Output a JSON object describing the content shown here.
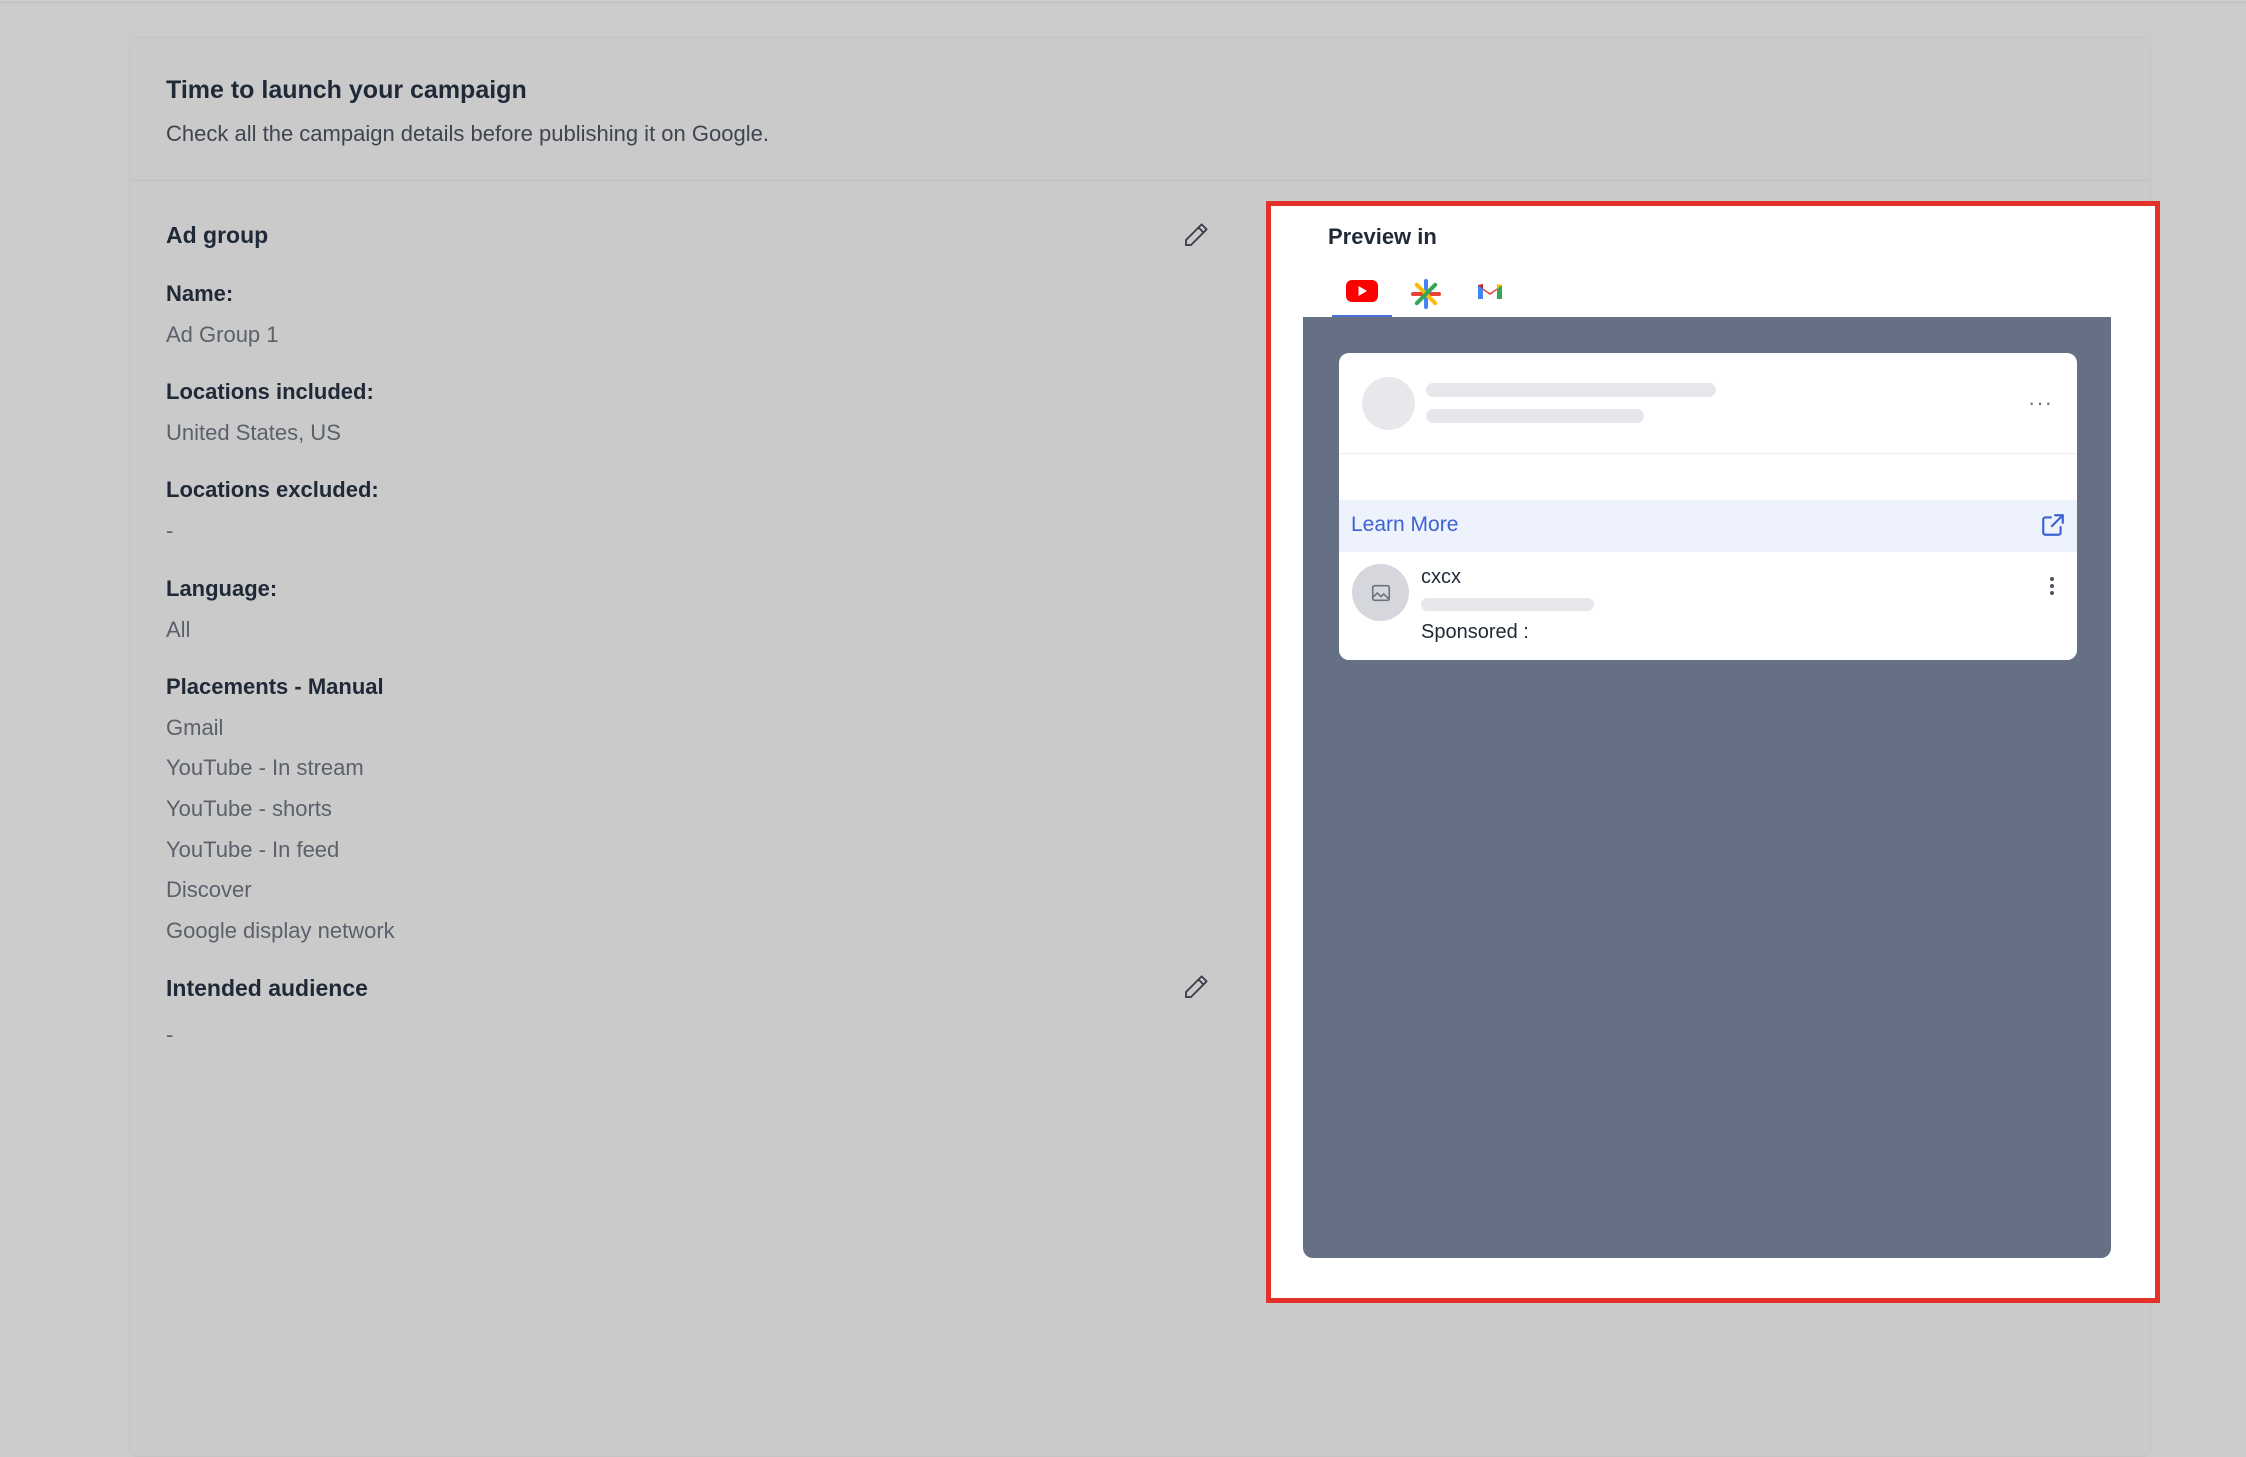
{
  "header": {
    "title": "Time to launch your campaign",
    "subtitle": "Check all the campaign details before publishing it on Google."
  },
  "ad_group": {
    "section_title": "Ad group",
    "name_label": "Name:",
    "name_value": "Ad Group 1",
    "locations_included_label": "Locations included:",
    "locations_included_value": "United States, US",
    "locations_excluded_label": "Locations excluded:",
    "locations_excluded_value": "-",
    "language_label": "Language:",
    "language_value": "All",
    "placements_label": "Placements - Manual",
    "placements": [
      "Gmail",
      "YouTube - In stream",
      "YouTube - shorts",
      "YouTube - In feed",
      "Discover",
      "Google display network"
    ]
  },
  "audience": {
    "section_title": "Intended audience",
    "value": "-"
  },
  "preview": {
    "title": "Preview in",
    "tabs": [
      {
        "icon": "youtube-icon",
        "active": true
      },
      {
        "icon": "google-discover-icon",
        "active": false
      },
      {
        "icon": "gmail-icon",
        "active": false
      }
    ],
    "cta_label": "Learn More",
    "channel_name": "cxcx",
    "sponsored_label": "Sponsored :",
    "more_label": "···"
  },
  "colors": {
    "highlight_border": "#e4312a",
    "stage_background": "#667085",
    "cta_text": "#3b63d1",
    "youtube_red": "#ff0000"
  }
}
